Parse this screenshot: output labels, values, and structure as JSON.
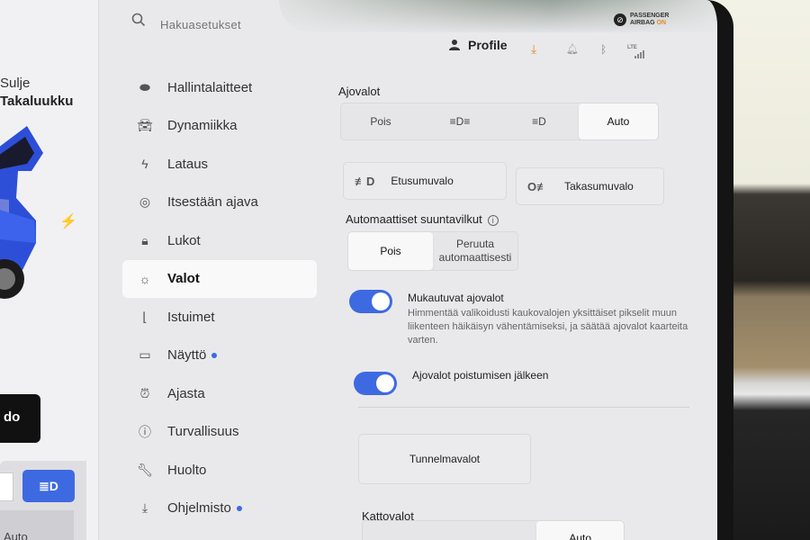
{
  "car_panel": {
    "close_label": "Sulje",
    "trunk_label": "Takaluukku",
    "do_button_label": "do",
    "mini_auto_label": "Auto"
  },
  "search": {
    "placeholder": "Hakuasetukset"
  },
  "status": {
    "airbag_line1": "PASSENGER",
    "airbag_line2": "AIRBAG",
    "airbag_state": "ON",
    "profile_label": "Profile",
    "lte_label": "LTE"
  },
  "menu": {
    "items": [
      {
        "label": "Hallintalaitteet",
        "icon": "toggle-icon"
      },
      {
        "label": "Dynamiikka",
        "icon": "car-icon"
      },
      {
        "label": "Lataus",
        "icon": "bolt-icon"
      },
      {
        "label": "Itsestään ajava",
        "icon": "steering-wheel-icon"
      },
      {
        "label": "Lukot",
        "icon": "lock-icon"
      },
      {
        "label": "Valot",
        "icon": "light-icon",
        "active": true
      },
      {
        "label": "Istuimet",
        "icon": "seat-icon"
      },
      {
        "label": "Näyttö",
        "icon": "display-icon",
        "dot": true
      },
      {
        "label": "Ajasta",
        "icon": "alarm-clock-icon"
      },
      {
        "label": "Turvallisuus",
        "icon": "alert-circle-icon"
      },
      {
        "label": "Huolto",
        "icon": "wrench-icon"
      },
      {
        "label": "Ohjelmisto",
        "icon": "download-icon",
        "dot": true
      }
    ]
  },
  "headlights": {
    "title": "Ajovalot",
    "options": [
      "Pois",
      "",
      "",
      "Auto"
    ],
    "selected": "Auto"
  },
  "fog": {
    "front_label": "Etusumuvalo",
    "rear_label": "Takasumuvalo"
  },
  "auto_signals": {
    "title": "Automaattiset suuntavilkut",
    "off_label": "Pois",
    "cancel_label": "Peruuta automaattisesti",
    "selected": "Pois"
  },
  "adaptive": {
    "label": "Mukautuvat ajovalot",
    "description": "Himmentää valikoidusti kaukovalojen yksittäiset pikselit muun liikenteen häikäisyn vähentämiseksi, ja säätää ajovalot kaarteita varten.",
    "on": true
  },
  "after_exit": {
    "label": "Ajovalot poistumisen jälkeen",
    "on": true
  },
  "ambient": {
    "label": "Tunnelmavalot"
  },
  "dome": {
    "title": "Kattovalot",
    "selected": "Auto"
  },
  "colors": {
    "accent": "#3e6ae1",
    "warning": "#e5892b"
  }
}
